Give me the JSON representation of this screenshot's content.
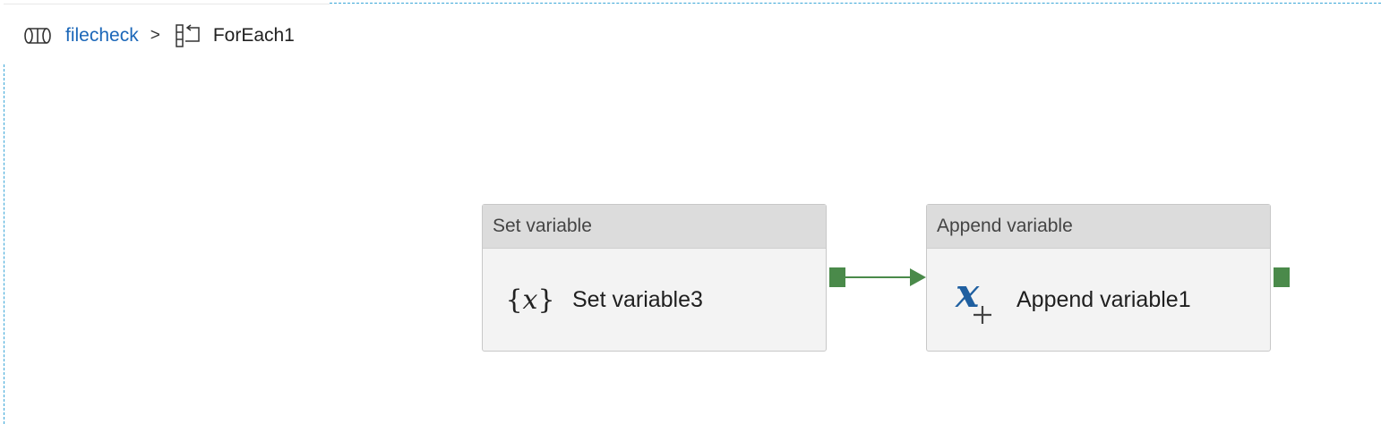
{
  "breadcrumb": {
    "pipeline_icon": "pipeline-icon",
    "pipeline_label": "filecheck",
    "separator": ">",
    "foreach_icon": "foreach-icon",
    "current_label": "ForEach1"
  },
  "activities": [
    {
      "type_label": "Set variable",
      "name": "Set variable3",
      "icon": "set-variable-icon"
    },
    {
      "type_label": "Append variable",
      "name": "Append variable1",
      "icon": "append-variable-icon"
    }
  ],
  "colors": {
    "link": "#1a66b8",
    "success_port": "#4a8a4a",
    "card_header": "#dcdcdc",
    "card_body": "#f3f3f3",
    "append_icon": "#1f5fa0"
  }
}
